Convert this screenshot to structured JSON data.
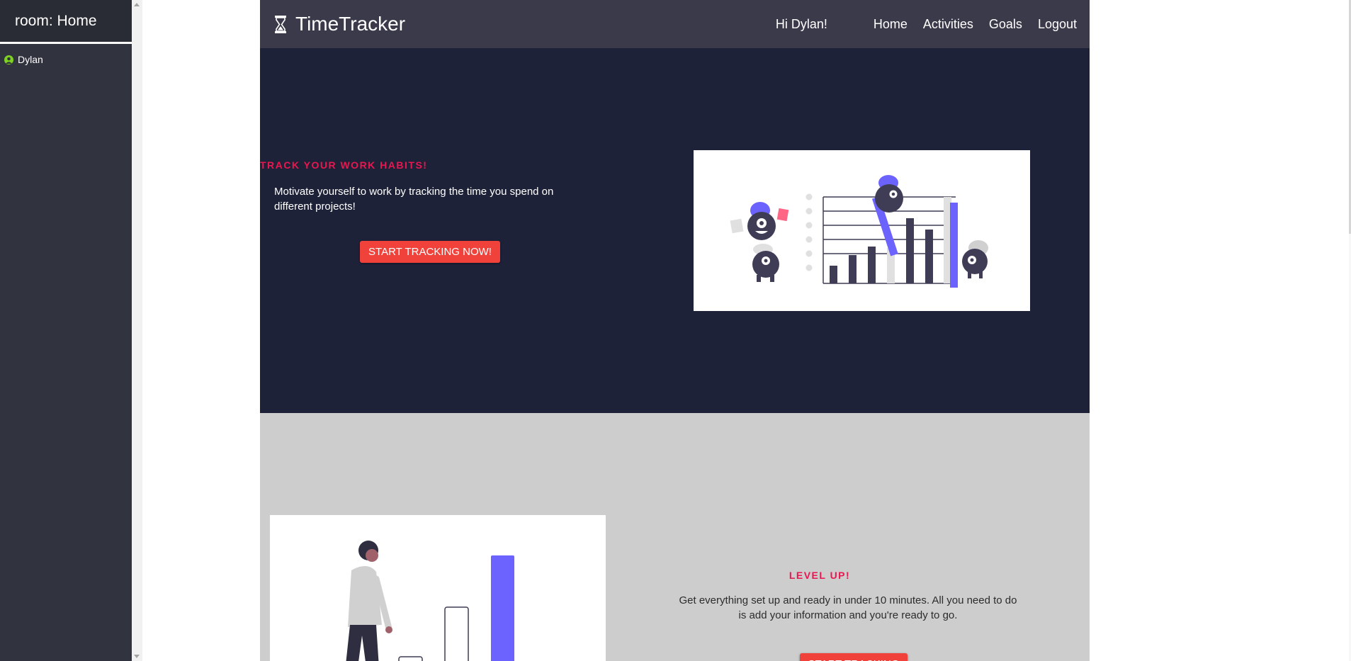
{
  "sidebar": {
    "room_title": "room: Home",
    "user_name": "Dylan"
  },
  "navbar": {
    "brand": "TimeTracker",
    "greeting": "Hi Dylan!",
    "links": [
      "Home",
      "Activities",
      "Goals",
      "Logout"
    ]
  },
  "hero": {
    "heading": "TRACK YOUR WORK HABITS!",
    "description": "Motivate yourself to work by tracking the time you spend on different projects!",
    "cta": "START TRACKING NOW!"
  },
  "section2": {
    "heading": "LEVEL UP!",
    "description": "Get everything set up and ready in under 10 minutes. All you need to do is add your information and you're ready to go.",
    "cta": "START TRACKING"
  },
  "colors": {
    "accent": "#e8174f",
    "button": "#f0413a",
    "illustration_purple": "#6c63ff",
    "hero_bg": "#1e2239",
    "navbar_bg": "#3a3a4a"
  }
}
